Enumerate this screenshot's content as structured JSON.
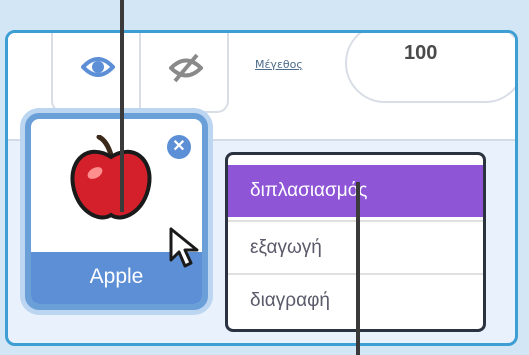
{
  "visibility": {
    "show_icon": "eye-icon",
    "hide_icon": "eye-slash-icon"
  },
  "size": {
    "label": "Μέγεθος",
    "value": "100"
  },
  "sprite": {
    "name": "Apple",
    "delete_icon": "close-icon",
    "costume_icon": "apple-icon"
  },
  "context_menu": {
    "items": [
      {
        "label": "διπλασιασμός",
        "highlighted": true
      },
      {
        "label": "εξαγωγή",
        "highlighted": false
      },
      {
        "label": "διαγραφή",
        "highlighted": false
      }
    ]
  },
  "colors": {
    "accent_blue": "#5c8fd6",
    "highlight_purple": "#8e55d6",
    "panel_border": "#3d9ed4"
  }
}
